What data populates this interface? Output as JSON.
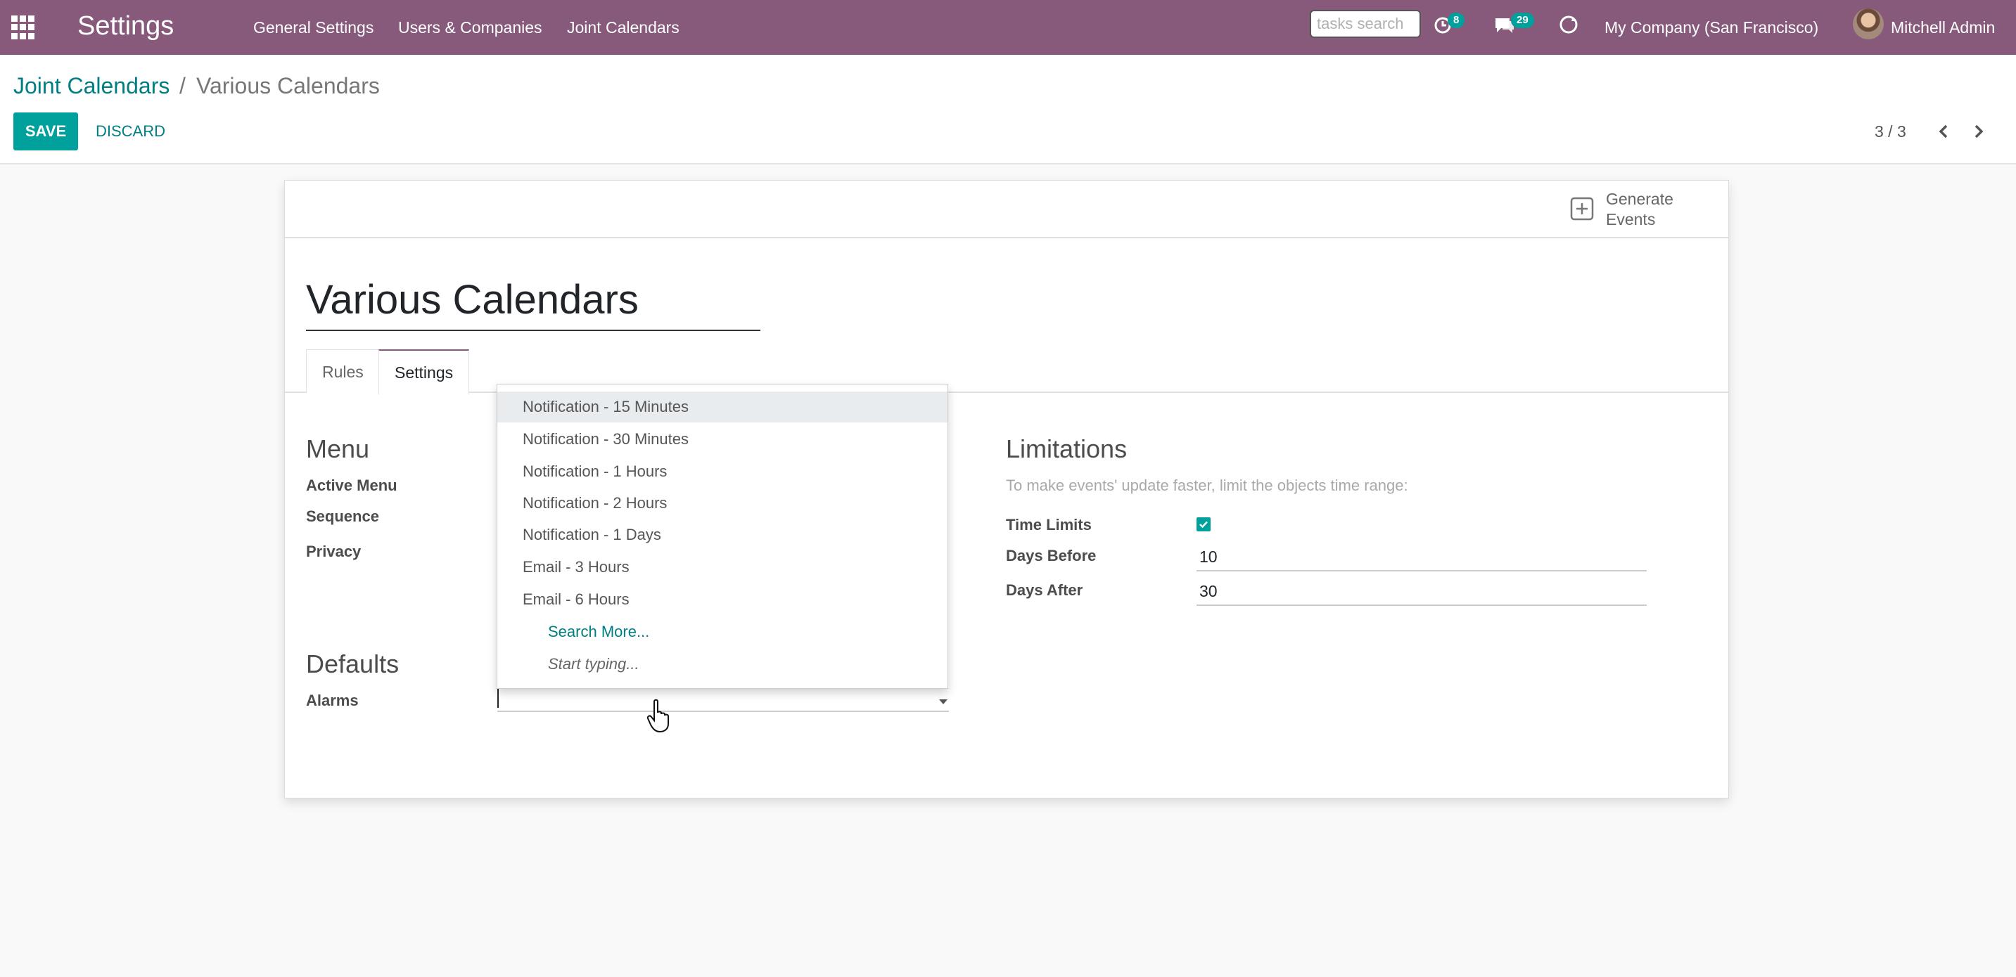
{
  "navbar": {
    "brand": "Settings",
    "menu": [
      "General Settings",
      "Users & Companies",
      "Joint Calendars"
    ],
    "search_placeholder": "tasks search",
    "activity_count": "8",
    "messages_count": "29",
    "company": "My Company (San Francisco)",
    "user": "Mitchell Admin"
  },
  "breadcrumb": {
    "parent": "Joint Calendars",
    "separator": "/",
    "current": "Various Calendars"
  },
  "buttons": {
    "save": "SAVE",
    "discard": "DISCARD"
  },
  "pager": {
    "value": "3 / 3"
  },
  "form": {
    "generate_events": "Generate Events",
    "title": "Various Calendars",
    "tabs": [
      "Rules",
      "Settings"
    ],
    "active_tab": "Settings",
    "menu_section": {
      "title": "Menu",
      "labels": [
        "Active Menu",
        "Sequence",
        "Privacy"
      ]
    },
    "defaults_section": {
      "title": "Defaults",
      "alarms_label": "Alarms",
      "alarms_value": ""
    },
    "limitations": {
      "title": "Limitations",
      "hint": "To make events' update faster, limit the objects time range:",
      "time_limits_label": "Time Limits",
      "time_limits_checked": true,
      "days_before_label": "Days Before",
      "days_before_value": "10",
      "days_after_label": "Days After",
      "days_after_value": "30"
    }
  },
  "dropdown": {
    "options": [
      "Notification - 15 Minutes",
      "Notification - 30 Minutes",
      "Notification - 1 Hours",
      "Notification - 2 Hours",
      "Notification - 1 Days",
      "Email - 3 Hours",
      "Email - 6 Hours"
    ],
    "highlighted": "Notification - 15 Minutes",
    "search_more": "Search More...",
    "start_typing": "Start typing..."
  },
  "colors": {
    "navbar": "#875a7b",
    "primary": "#00a09d",
    "link": "#017e84"
  }
}
